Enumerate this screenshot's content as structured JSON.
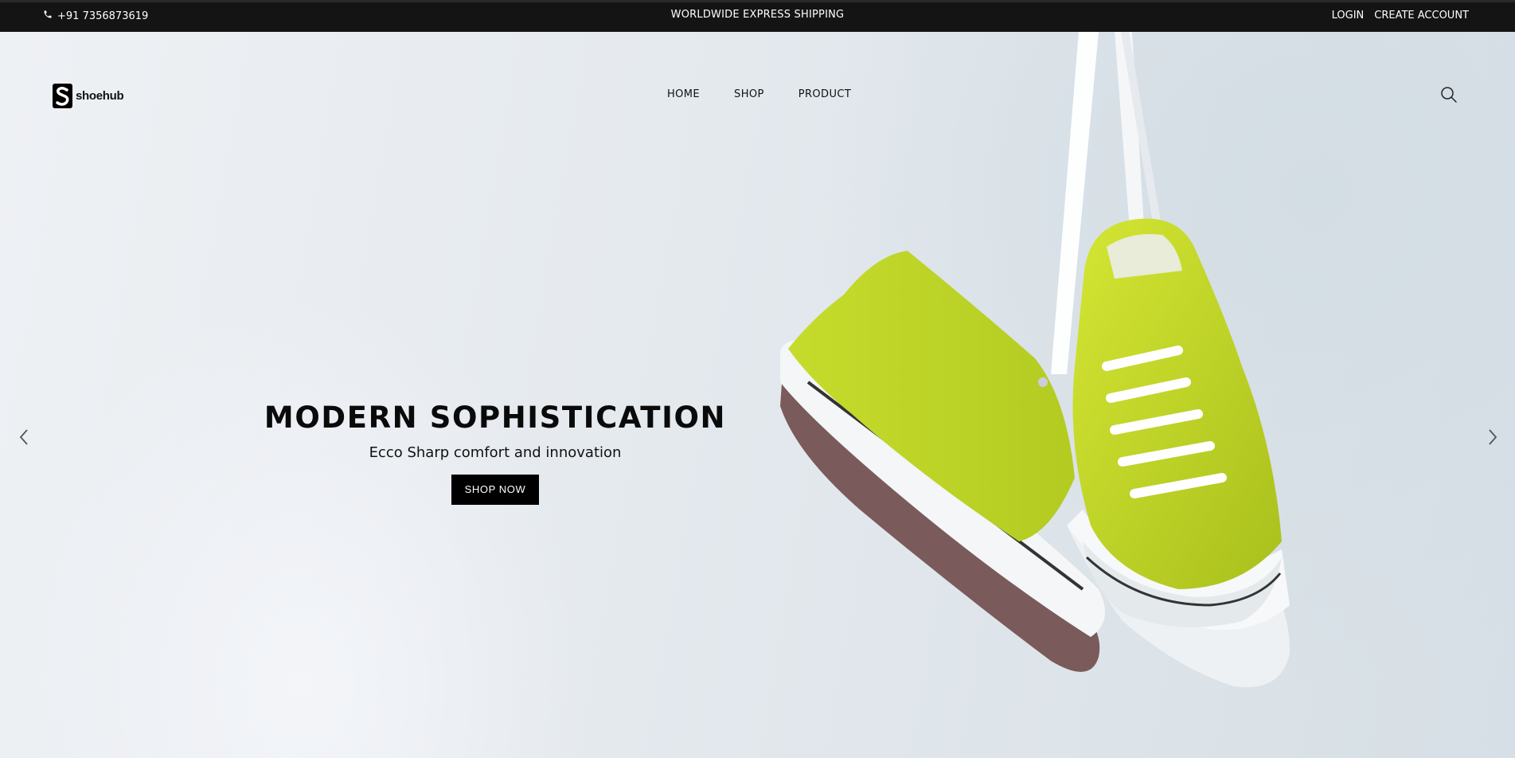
{
  "topbar": {
    "phone": "+91 7356873619",
    "shipping": "WORLDWIDE EXPRESS SHIPPING",
    "login": "LOGIN",
    "create_account": "CREATE ACCOUNT"
  },
  "header": {
    "logo_text": "shoehub",
    "nav": [
      "HOME",
      "SHOP",
      "PRODUCT"
    ]
  },
  "hero": {
    "title": "MODERN SOPHISTICATION",
    "subtitle": "Ecco Sharp comfort and innovation",
    "cta": "SHOP NOW"
  },
  "icons": {
    "phone": "phone-icon",
    "search": "search-icon",
    "prev": "chevron-left-icon",
    "next": "chevron-right-icon"
  },
  "colors": {
    "topbar_bg": "#141414",
    "button_bg": "#000000",
    "shoe_green": "#c3d92a"
  }
}
